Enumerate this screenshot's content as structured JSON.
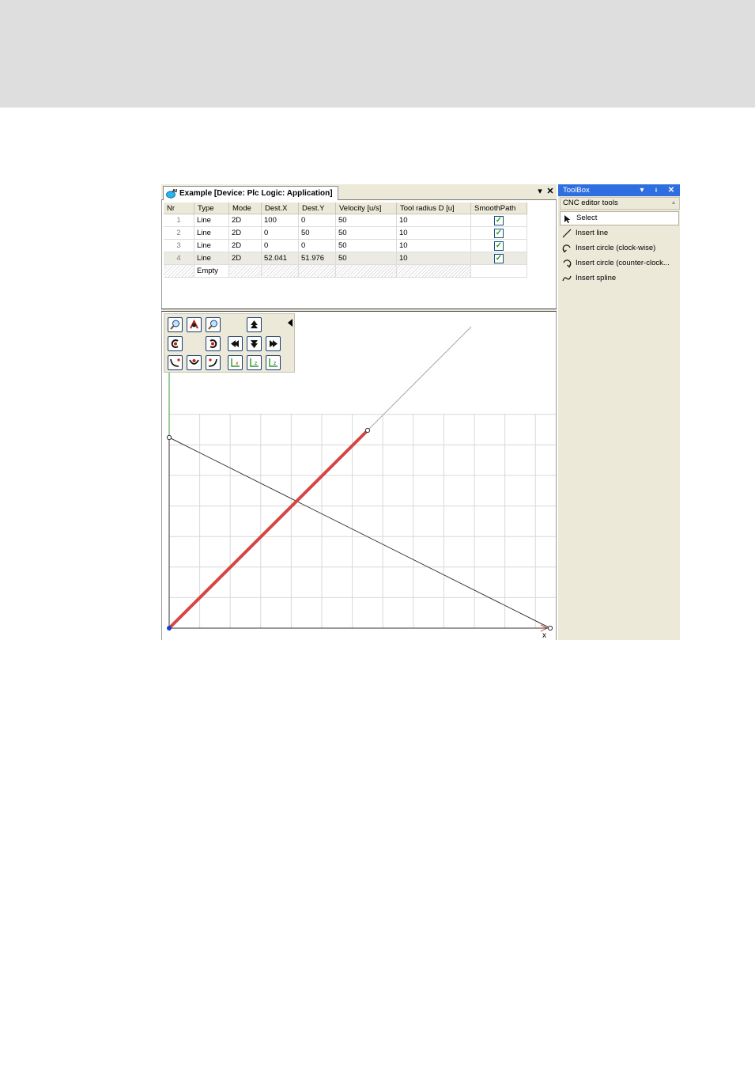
{
  "editor": {
    "tab_title": "Example [Device: Plc Logic: Application]",
    "table": {
      "headers": [
        "Nr",
        "Type",
        "Mode",
        "Dest.X",
        "Dest.Y",
        "Velocity [u/s]",
        "Tool radius D [u]",
        "SmoothPath"
      ],
      "rows": [
        {
          "nr": "1",
          "type": "Line",
          "mode": "2D",
          "dest_x": "100",
          "dest_y": "0",
          "velocity": "50",
          "tool_radius": "10",
          "smooth_path": true
        },
        {
          "nr": "2",
          "type": "Line",
          "mode": "2D",
          "dest_x": "0",
          "dest_y": "50",
          "velocity": "50",
          "tool_radius": "10",
          "smooth_path": true
        },
        {
          "nr": "3",
          "type": "Line",
          "mode": "2D",
          "dest_x": "0",
          "dest_y": "0",
          "velocity": "50",
          "tool_radius": "10",
          "smooth_path": true
        },
        {
          "nr": "4",
          "type": "Line",
          "mode": "2D",
          "dest_x": "52.041",
          "dest_y": "51.976",
          "velocity": "50",
          "tool_radius": "10",
          "smooth_path": true
        }
      ],
      "empty_row": {
        "type": "Empty"
      }
    },
    "canvas": {
      "x_axis_label": "x",
      "colors": {
        "selected_segment": "#d64545",
        "path": "#333333",
        "grid": "#d8d8d8",
        "y_axis": "#3a9a3a",
        "x_arrow": "#e05050",
        "origin": "#1040d0"
      }
    },
    "toolbar_icons": [
      "zoom-in-icon",
      "zoom-fit-icon",
      "zoom-out-icon",
      "move-up-icon",
      "rotate-left-icon",
      "rotate-right-icon",
      "move-left-icon",
      "move-down-icon",
      "move-right-icon",
      "curve-tool-1-icon",
      "curve-tool-2-icon",
      "curve-tool-3-icon",
      "view-xy-icon",
      "view-xz-icon",
      "view-yz-icon"
    ]
  },
  "toolbox": {
    "title": "ToolBox",
    "category": "CNC editor tools",
    "items": [
      {
        "label": "Select",
        "icon": "pointer-icon"
      },
      {
        "label": "Insert line",
        "icon": "line-icon"
      },
      {
        "label": "Insert circle (clock-wise)",
        "icon": "circle-cw-icon"
      },
      {
        "label": "Insert circle (counter-clock...",
        "icon": "circle-ccw-icon"
      },
      {
        "label": "Insert spline",
        "icon": "spline-icon"
      }
    ]
  }
}
